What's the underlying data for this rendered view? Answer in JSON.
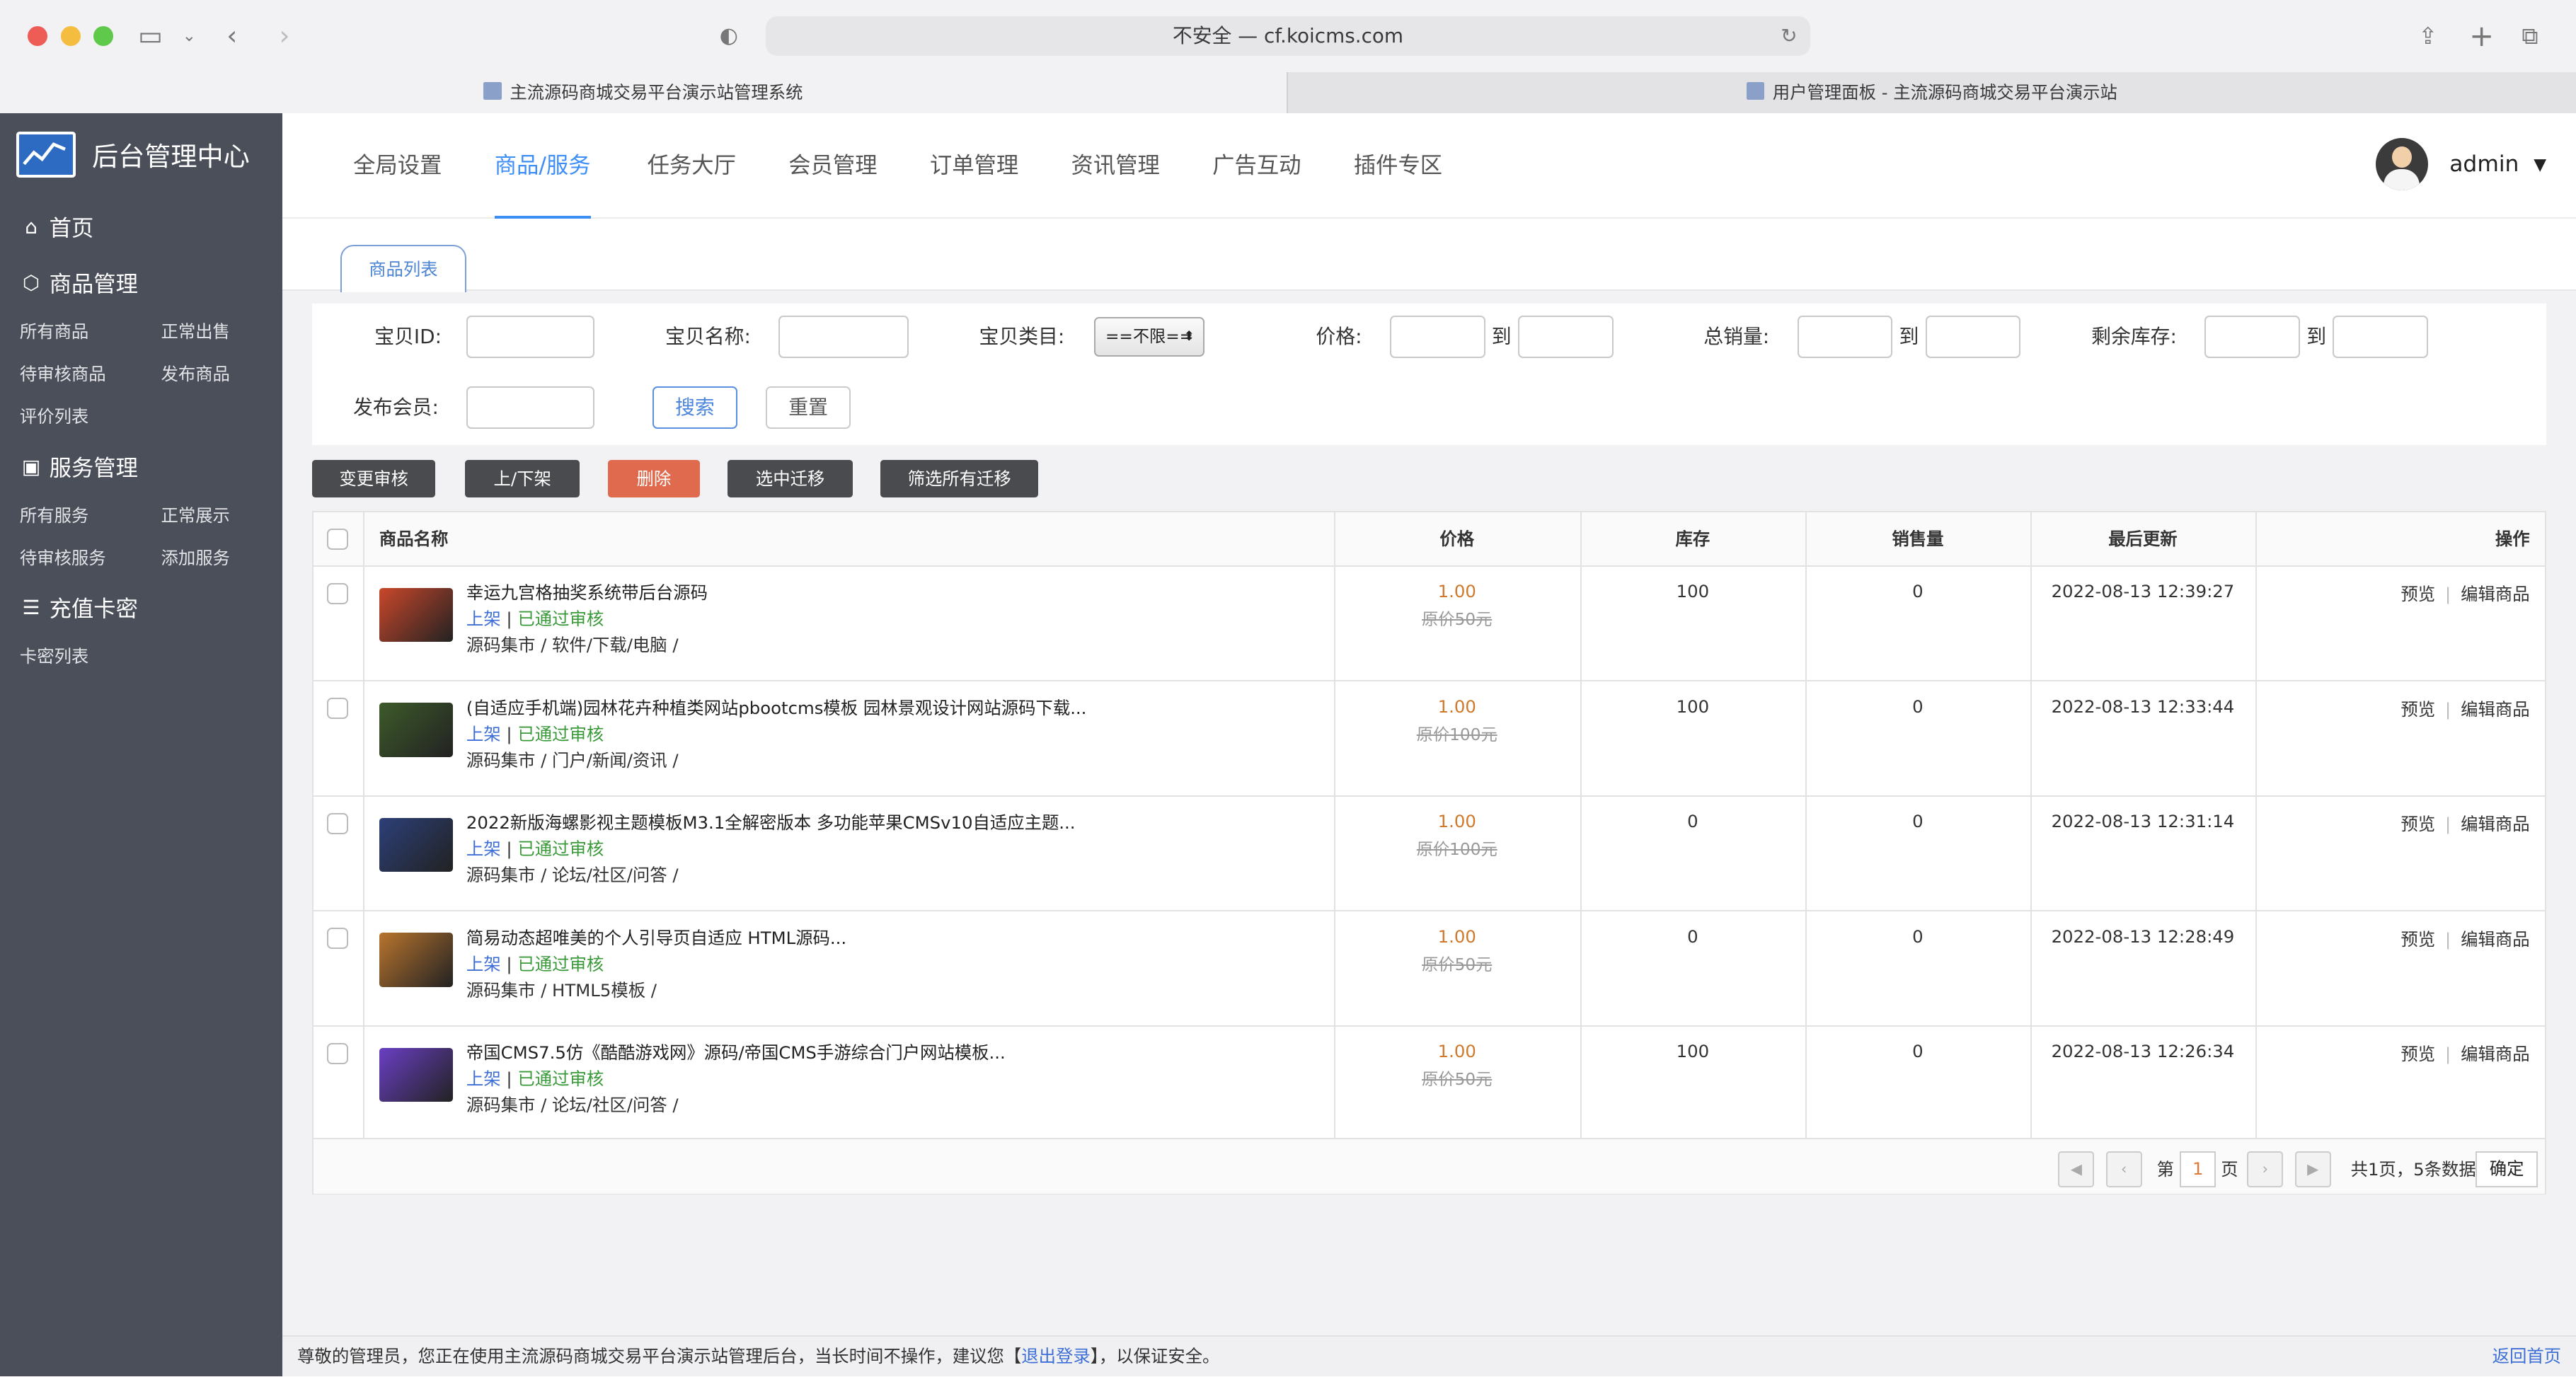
{
  "browser": {
    "url": "不安全 — cf.koicms.com",
    "tabs": [
      {
        "label": "主流源码商城交易平台演示站管理系统"
      },
      {
        "label": "用户管理面板 - 主流源码商城交易平台演示站"
      }
    ]
  },
  "sidebar": {
    "title": "后台管理中心",
    "home": "首页",
    "sections": [
      {
        "title": "商品管理",
        "items": [
          "所有商品",
          "正常出售",
          "待审核商品",
          "发布商品",
          "评价列表"
        ]
      },
      {
        "title": "服务管理",
        "items": [
          "所有服务",
          "正常展示",
          "待审核服务",
          "添加服务"
        ]
      },
      {
        "title": "充值卡密",
        "items": [
          "卡密列表"
        ]
      }
    ]
  },
  "topnav": {
    "items": [
      "全局设置",
      "商品/服务",
      "任务大厅",
      "会员管理",
      "订单管理",
      "资讯管理",
      "广告互动",
      "插件专区"
    ],
    "active": "商品/服务",
    "user": "admin"
  },
  "subtab": "商品列表",
  "filter": {
    "id_label": "宝贝ID:",
    "name_label": "宝贝名称:",
    "category_label": "宝贝类目:",
    "category_value": "==不限==",
    "price_label": "价格:",
    "to": "到",
    "sales_label": "总销量:",
    "stock_label": "剩余库存:",
    "member_label": "发布会员:",
    "search_btn": "搜索",
    "reset_btn": "重置"
  },
  "actions": [
    "变更审核",
    "上/下架",
    "删除",
    "选中迁移",
    "筛选所有迁移"
  ],
  "table": {
    "headers": {
      "name": "商品名称",
      "price": "价格",
      "stock": "库存",
      "sales": "销售量",
      "updated": "最后更新",
      "ops": "操作"
    },
    "rows": [
      {
        "title": "幸运九宫格抽奖系统带后台源码",
        "status_on": "上架",
        "status_sep": "|",
        "status_review": "已通过审核",
        "category": "源码集市 / 软件/下载/电脑 /",
        "price": "1.00",
        "original": "原价50元",
        "stock": "100",
        "sales": "0",
        "updated": "2022-08-13 12:39:27",
        "preview": "预览",
        "edit": "编辑商品",
        "thumb_color": "#c9472b"
      },
      {
        "title": "(自适应手机端)园林花卉种植类网站pbootcms模板 园林景观设计网站源码下载...",
        "status_on": "上架",
        "status_sep": "|",
        "status_review": "已通过审核",
        "category": "源码集市 / 门户/新闻/资讯 /",
        "price": "1.00",
        "original": "原价100元",
        "stock": "100",
        "sales": "0",
        "updated": "2022-08-13 12:33:44",
        "preview": "预览",
        "edit": "编辑商品",
        "thumb_color": "#3d5a2a"
      },
      {
        "title": "2022新版海螺影视主题模板M3.1全解密版本 多功能苹果CMSv10自适应主题...",
        "status_on": "上架",
        "status_sep": "|",
        "status_review": "已通过审核",
        "category": "源码集市 / 论坛/社区/问答 /",
        "price": "1.00",
        "original": "原价100元",
        "stock": "0",
        "sales": "0",
        "updated": "2022-08-13 12:31:14",
        "preview": "预览",
        "edit": "编辑商品",
        "thumb_color": "#2c3f78"
      },
      {
        "title": "简易动态超唯美的个人引导页自适应 HTML源码...",
        "status_on": "上架",
        "status_sep": "|",
        "status_review": "已通过审核",
        "category": "源码集市 / HTML5模板 /",
        "price": "1.00",
        "original": "原价50元",
        "stock": "0",
        "sales": "0",
        "updated": "2022-08-13 12:28:49",
        "preview": "预览",
        "edit": "编辑商品",
        "thumb_color": "#b8742e"
      },
      {
        "title": "帝国CMS7.5仿《酷酷游戏网》源码/帝国CMS手游综合门户网站模板...",
        "status_on": "上架",
        "status_sep": "|",
        "status_review": "已通过审核",
        "category": "源码集市 / 论坛/社区/问答 /",
        "price": "1.00",
        "original": "原价50元",
        "stock": "100",
        "sales": "0",
        "updated": "2022-08-13 12:26:34",
        "preview": "预览",
        "edit": "编辑商品",
        "thumb_color": "#6a3fc4"
      }
    ]
  },
  "pager": {
    "prefix": "第",
    "page": "1",
    "suffix": "页",
    "summary": "共1页，5条数据",
    "confirm": "确定"
  },
  "footer": {
    "text_before": "尊敬的管理员，您正在使用主流源码商城交易平台演示站管理后台，当长时间不操作，建议您【",
    "logout": "退出登录",
    "text_after": "】，以保证安全。",
    "back_home": "返回首页"
  }
}
